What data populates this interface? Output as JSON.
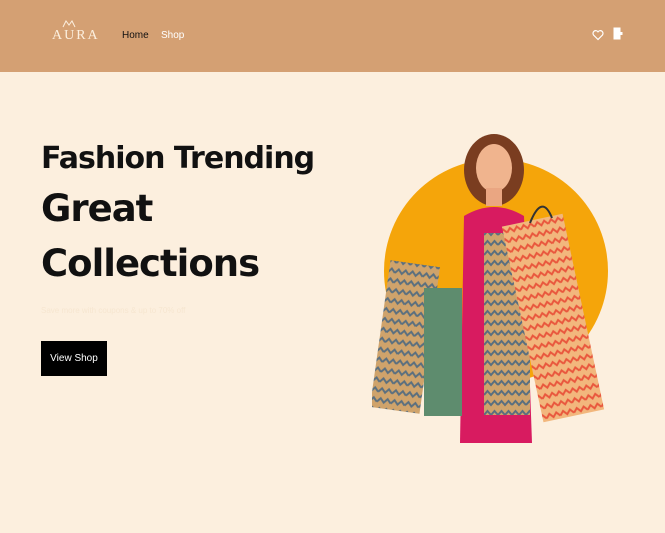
{
  "brand": {
    "logo_text": "AURA",
    "colors": {
      "header_bg": "#d4a073",
      "page_bg": "#fcefde",
      "accent_circle": "#f5a50a",
      "button_bg": "#000000"
    }
  },
  "nav": {
    "items": [
      {
        "label": "Home",
        "active": true
      },
      {
        "label": "Shop",
        "active": false
      }
    ],
    "icons": [
      "heart-icon",
      "bag-icon"
    ]
  },
  "hero": {
    "title_line_1": "Fashion Trending",
    "title_line_2": "Great",
    "title_line_3": "Collections",
    "subtitle": "Save more with coupons & up to 70% off",
    "cta_label": "View Shop"
  }
}
